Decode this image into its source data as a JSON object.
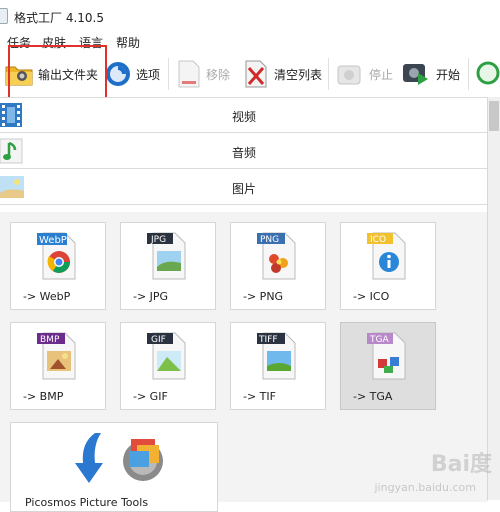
{
  "window": {
    "title": "格式工厂 4.10.5"
  },
  "menu": {
    "items": [
      "任务",
      "皮肤",
      "语言",
      "帮助"
    ]
  },
  "toolbar": {
    "output_folder": "输出文件夹",
    "options": "选项",
    "remove": "移除",
    "clear_list": "清空列表",
    "stop": "停止",
    "start": "开始"
  },
  "categories": {
    "video": "视频",
    "audio": "音频",
    "image": "图片"
  },
  "image_formats": [
    {
      "label": "-> WebP",
      "badge": "WebP",
      "badge_color": "#2a7fd1"
    },
    {
      "label": "-> JPG",
      "badge": "JPG",
      "badge_color": "#2b3340"
    },
    {
      "label": "-> PNG",
      "badge": "PNG",
      "badge_color": "#3a6fb0"
    },
    {
      "label": "-> ICO",
      "badge": "ICO",
      "badge_color": "#f2c12e"
    },
    {
      "label": "-> BMP",
      "badge": "BMP",
      "badge_color": "#6b2c8c"
    },
    {
      "label": "-> GIF",
      "badge": "GIF",
      "badge_color": "#2b3340"
    },
    {
      "label": "-> TIF",
      "badge": "TIFF",
      "badge_color": "#2b3340"
    },
    {
      "label": "-> TGA",
      "badge": "TGA",
      "badge_color": "#b889c9"
    }
  ],
  "extra_tool": {
    "label": "Picosmos Picture Tools"
  },
  "watermark": {
    "main": "Bai度",
    "sub": "jingyan.baidu.com"
  },
  "colors": {
    "highlight": "#e0322b",
    "accent": "#2a7fd1",
    "start_green": "#2ea043"
  }
}
